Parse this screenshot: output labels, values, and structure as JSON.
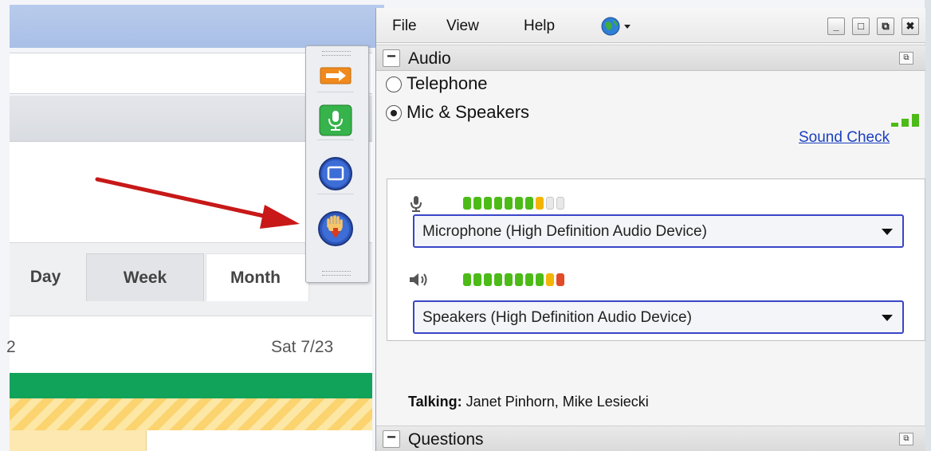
{
  "background_page": {
    "tabs": [
      "Day",
      "Week",
      "Month"
    ],
    "date_left": "2",
    "date_sat": "Sat 7/23"
  },
  "toolbar": {
    "buttons": [
      {
        "name": "arrow-icon"
      },
      {
        "name": "microphone-icon"
      },
      {
        "name": "screen-share-icon"
      },
      {
        "name": "raise-hand-icon"
      }
    ]
  },
  "menu": {
    "file": "File",
    "view": "View",
    "help": "Help",
    "globe_caret": "▾"
  },
  "window_controls": {
    "minimize": "_",
    "maximize": "□",
    "restore": "⧉",
    "close": "✖"
  },
  "audio": {
    "section_title": "Audio",
    "collapse_symbol": "−",
    "options": [
      {
        "label": "Telephone",
        "selected": false
      },
      {
        "label": "Mic & Speakers",
        "selected": true
      }
    ],
    "sound_check": "Sound Check",
    "mic_level": {
      "lit": 8,
      "total": 10
    },
    "speaker_level": {
      "lit": 10,
      "total": 10
    },
    "microphone_device": "Microphone (High Definition Audio Device)",
    "speaker_device": "Speakers (High Definition Audio Device)",
    "talking_label": "Talking:",
    "talking_names": " Janet Pinhorn, Mike Lesiecki"
  },
  "questions": {
    "section_title": "Questions",
    "collapse_symbol": "−"
  },
  "colors": {
    "accent_blue": "#3a45c8",
    "link_blue": "#1a3fbf",
    "meter_green": "#4cbb17",
    "meter_yellow": "#f4b400",
    "meter_red": "#e24b26",
    "calendar_green": "#12a35b",
    "arrow_red": "#c81818"
  }
}
